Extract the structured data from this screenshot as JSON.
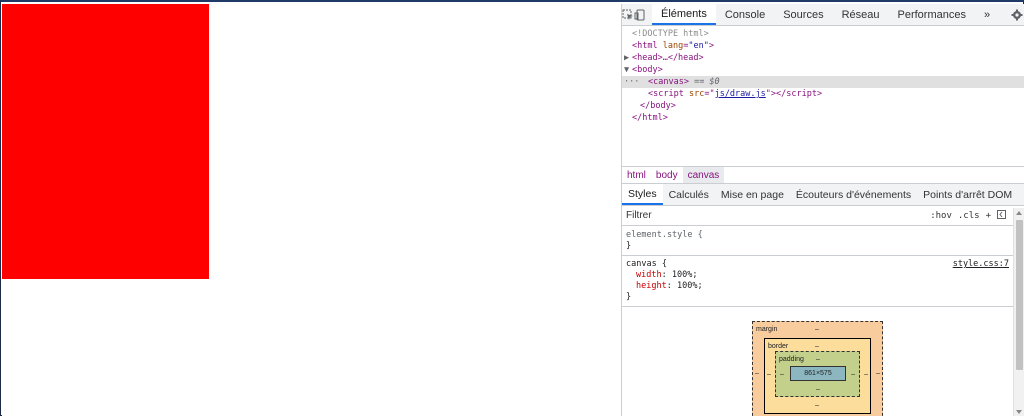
{
  "colors": {
    "canvas_fill": "#ff0000",
    "accent": "#1a73e8"
  },
  "toolbar": {
    "tabs": [
      "Éléments",
      "Console",
      "Sources",
      "Réseau",
      "Performances"
    ],
    "more": "»",
    "inspect_icon": "inspect-cursor-icon",
    "device_icon": "device-toggle-icon",
    "settings_icon": "gear-icon",
    "menu_icon": "kebab-menu-icon"
  },
  "dom": {
    "doctype": "<!DOCTYPE html>",
    "html_open_tag": "html",
    "lang_attr": "lang",
    "lang_value": "\"en\"",
    "head": "<head>…</head>",
    "body_open": "<body>",
    "canvas": "<canvas>",
    "canvas_eq": "== $0",
    "script_tag": "script",
    "script_src_attr": "src",
    "script_src": "js/draw.js",
    "body_close": "</body>",
    "html_close": "</html>",
    "dots": "···"
  },
  "breadcrumb": [
    "html",
    "body",
    "canvas"
  ],
  "styles_tabs": [
    "Styles",
    "Calculés",
    "Mise en page",
    "Écouteurs d'événements",
    "Points d'arrêt DOM"
  ],
  "styles_more": "»",
  "filter": {
    "placeholder": "Filtrer",
    "hov": ":hov",
    "cls": ".cls",
    "plus": "+"
  },
  "rules": {
    "element_style": {
      "selector": "element.style {",
      "close": "}"
    },
    "canvas": {
      "selector": "canvas {",
      "source": "style.css:7",
      "props": [
        {
          "name": "width",
          "value": "100%;"
        },
        {
          "name": "height",
          "value": "100%;"
        }
      ],
      "close": "}"
    }
  },
  "box_model": {
    "margin_label": "margin",
    "border_label": "border",
    "padding_label": "padding",
    "content": "861×575",
    "dash": "–"
  }
}
